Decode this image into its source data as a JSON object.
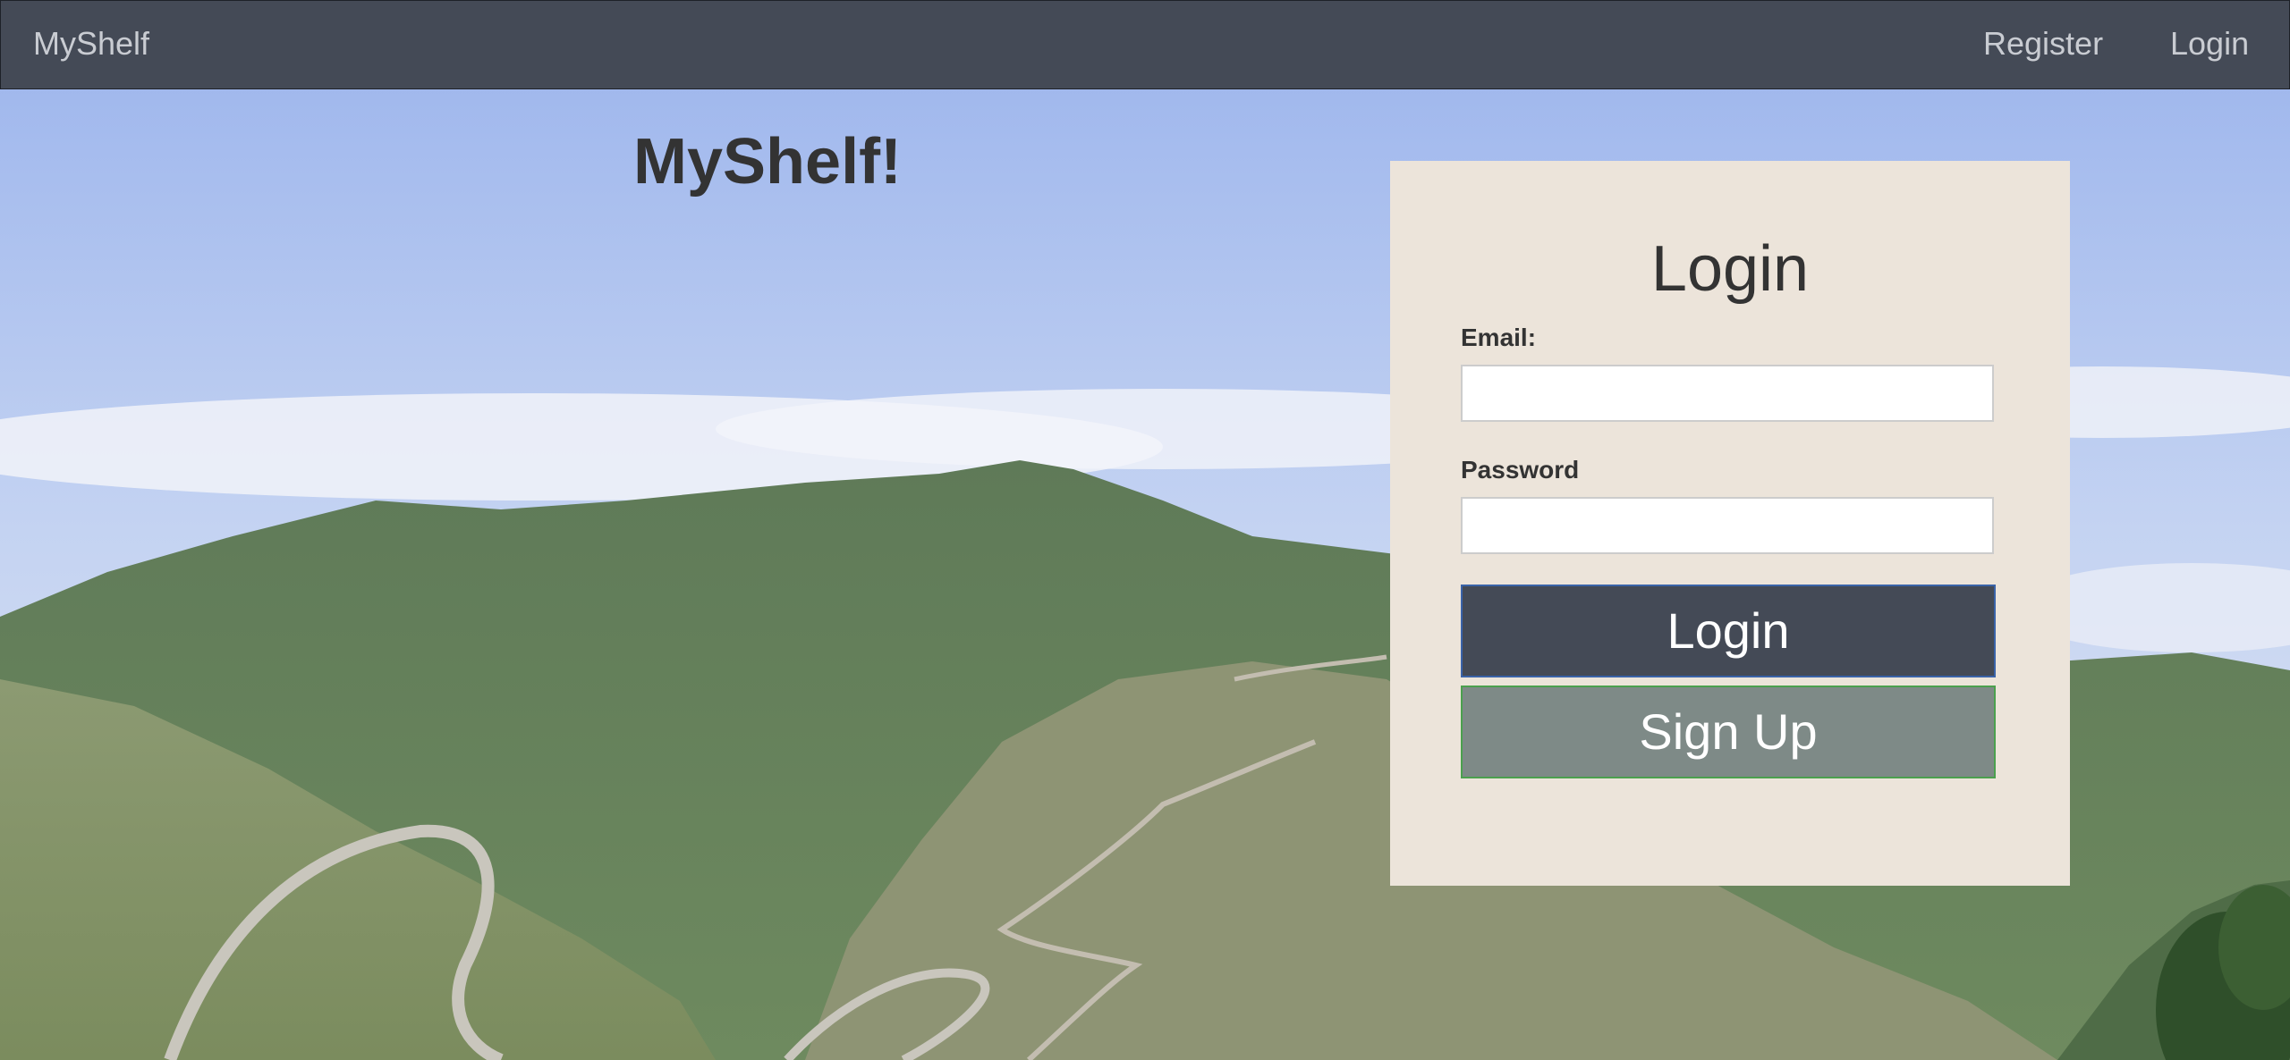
{
  "navbar": {
    "brand": "MyShelf",
    "links": [
      {
        "label": "Register"
      },
      {
        "label": "Login"
      }
    ]
  },
  "hero": {
    "title": "MyShelf!"
  },
  "login_form": {
    "heading": "Login",
    "email_label": "Email:",
    "email_value": "",
    "password_label": "Password",
    "password_value": "",
    "login_button": "Login",
    "signup_button": "Sign Up"
  },
  "colors": {
    "navbar": "#444a56",
    "card": "#ece4da",
    "login_button": "#444a56",
    "signup_button": "#7e8a87"
  }
}
